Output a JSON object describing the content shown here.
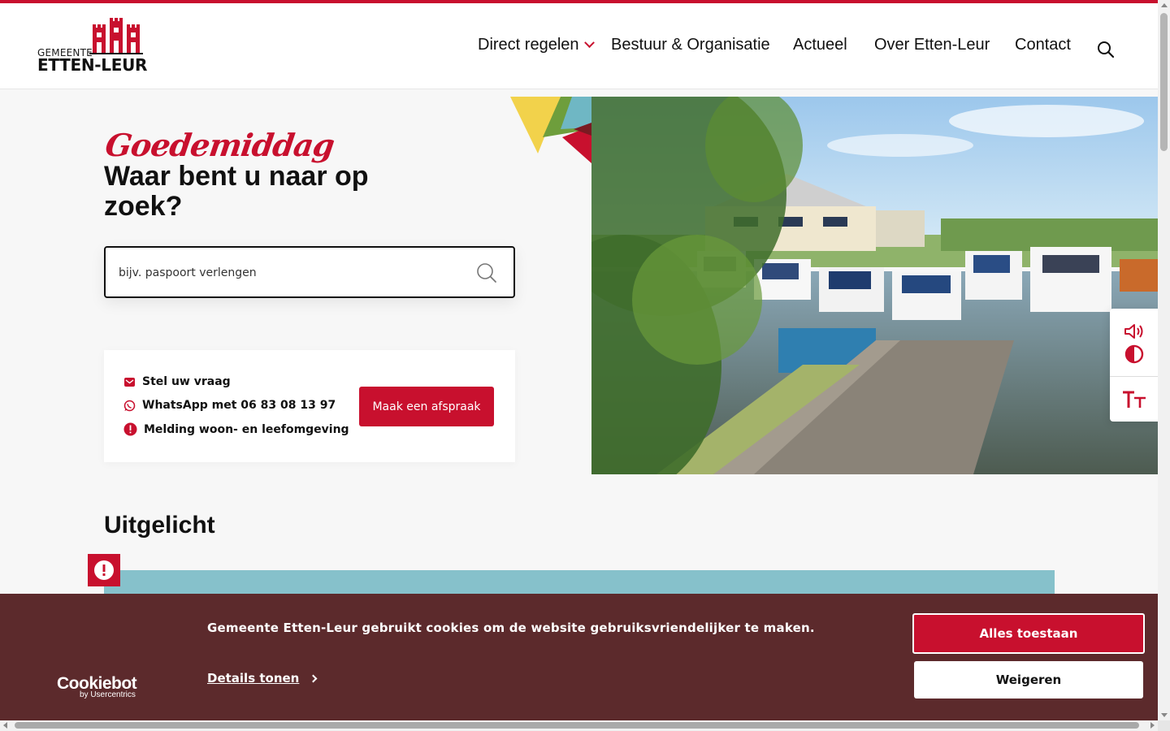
{
  "header": {
    "logo_small": "GEMEENTE",
    "logo_big": "ETTEN-LEUR",
    "nav": [
      {
        "label": "Direct regelen",
        "dropdown": true
      },
      {
        "label": "Bestuur & Organisatie"
      },
      {
        "label": "Actueel"
      },
      {
        "label": "Over Etten-Leur"
      },
      {
        "label": "Contact"
      }
    ],
    "search_icon": "search-icon"
  },
  "hero": {
    "greeting": "Goedemiddag",
    "headline": "Waar bent u naar op zoek?",
    "search_placeholder": "bijv. paspoort verlengen",
    "contact": {
      "items": [
        {
          "icon": "mail-icon",
          "label": "Stel uw vraag"
        },
        {
          "icon": "whatsapp-icon",
          "label": "WhatsApp met 06 83 08 13 97"
        },
        {
          "icon": "alert-icon",
          "label": "Melding woon- en leefomgeving"
        }
      ],
      "cta": "Maak een afspraak"
    }
  },
  "accessibility_tools": [
    "speaker-icon",
    "contrast-icon",
    "text-size-icon"
  ],
  "featured": {
    "title": "Uitgelicht"
  },
  "cookie_banner": {
    "brand": "Cookiebot",
    "brand_sub": "by Usercentrics",
    "message": "Gemeente Etten-Leur gebruikt cookies om de website gebruiksvriendelijker te maken.",
    "details": "Details tonen",
    "allow": "Alles toestaan",
    "refuse": "Weigeren"
  },
  "colors": {
    "brand_red": "#c8102e",
    "cookie_bg": "#5c2a2c",
    "feature_teal": "#86c1cb"
  }
}
